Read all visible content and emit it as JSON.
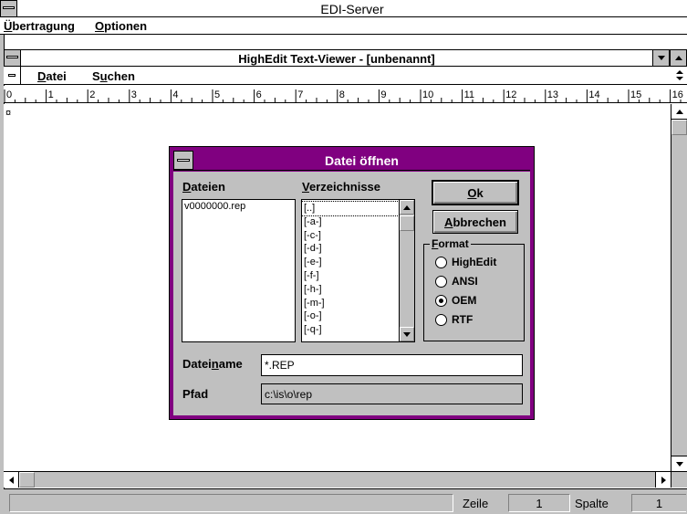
{
  "app": {
    "title": "EDI-Server"
  },
  "menubar": {
    "items": [
      {
        "label": "Übertragung",
        "accel": "Ü",
        "rest": "bertragung"
      },
      {
        "label": "Optionen",
        "accel": "O",
        "rest": "ptionen"
      }
    ]
  },
  "child": {
    "title": "HighEdit Text-Viewer - [unbenannt]",
    "menu": [
      {
        "label": "Datei",
        "accel": "D",
        "rest": "atei"
      },
      {
        "label": "Suchen",
        "pre": "S",
        "accel": "u",
        "rest": "chen"
      }
    ],
    "ruler_numbers": [
      "0",
      "1",
      "2",
      "3",
      "4",
      "5",
      "6",
      "7",
      "8",
      "9",
      "10",
      "11",
      "12",
      "13",
      "14",
      "15",
      "16"
    ],
    "paragraph_mark": "¤"
  },
  "dialog": {
    "title": "Datei öffnen",
    "files_label": {
      "accel": "D",
      "rest": "ateien"
    },
    "files": [
      "v0000000.rep"
    ],
    "dirs_label": {
      "accel": "V",
      "rest": "erzeichnisse"
    },
    "dirs": [
      "[..]",
      "[-a-]",
      "[-c-]",
      "[-d-]",
      "[-e-]",
      "[-f-]",
      "[-h-]",
      "[-m-]",
      "[-o-]",
      "[-q-]"
    ],
    "ok": {
      "accel": "O",
      "rest": "k"
    },
    "cancel": {
      "accel": "A",
      "rest": "bbrechen"
    },
    "format_label": {
      "accel": "F",
      "rest": "ormat"
    },
    "formats": [
      "HighEdit",
      "ANSI",
      "OEM",
      "RTF"
    ],
    "selected_format": "OEM",
    "filename_label": {
      "pre": "Datei",
      "accel": "n",
      "rest": "ame"
    },
    "filename_value": "*.REP",
    "path_label": "Pfad",
    "path_value": "c:\\is\\o\\rep"
  },
  "status": {
    "line_label": "Zeile",
    "line_value": "1",
    "col_label": "Spalte",
    "col_value": "1"
  }
}
